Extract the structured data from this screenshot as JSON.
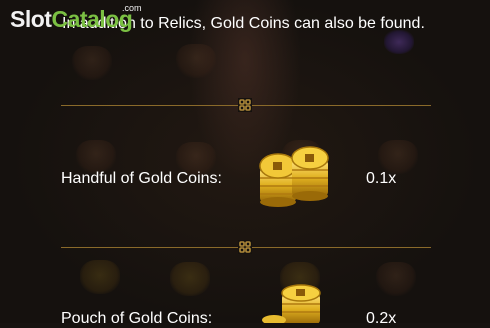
{
  "logo": {
    "brand_part1": "Slot",
    "brand_part2": "Catalog",
    "suffix": ".com"
  },
  "intro": {
    "text": "In addition to Relics, Gold Coins can also be found."
  },
  "items": [
    {
      "name": "Handful of Gold Coins:",
      "multiplier": "0.1x",
      "icon": "gold-coins-pile-icon"
    },
    {
      "name": "Pouch of Gold Coins:",
      "multiplier": "0.2x",
      "icon": "gold-coins-stack-icon"
    }
  ],
  "divider_icon": "knot-ornament-icon",
  "colors": {
    "background": "#15110e",
    "text": "#ffffff",
    "divider": "#8a6a2a",
    "gold": "#e0b020",
    "logo_green": "#7bc043"
  }
}
